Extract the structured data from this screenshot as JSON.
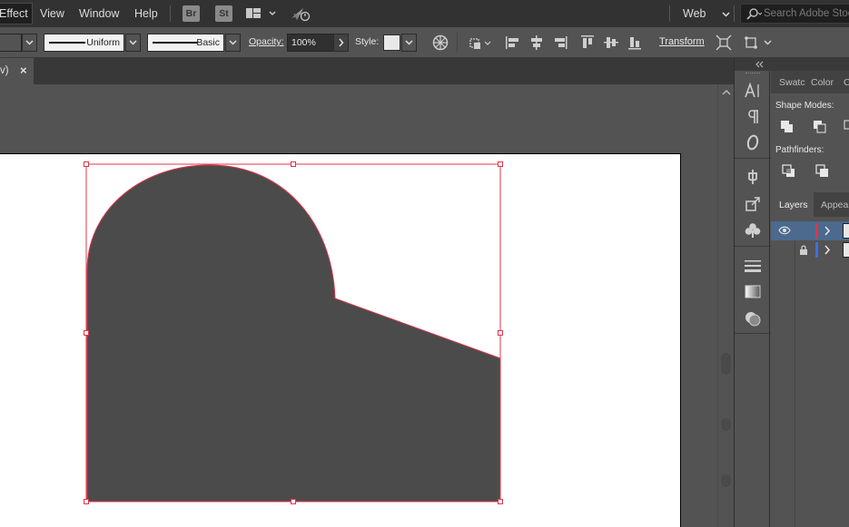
{
  "menubar": {
    "items": [
      {
        "label": "Effect",
        "active": true
      },
      {
        "label": "View"
      },
      {
        "label": "Window"
      },
      {
        "label": "Help"
      }
    ],
    "app_buttons": [
      "Br",
      "St"
    ],
    "workspace": "Web",
    "search_placeholder": "Search Adobe Stock"
  },
  "controlbar": {
    "stroke_profile": "Uniform",
    "brush": "Basic",
    "opacity_label": "Opacity:",
    "opacity_value": "100%",
    "style_label": "Style:",
    "transform_label": "Transform"
  },
  "document_tab": {
    "title_fragment": "v)",
    "close_glyph": "×"
  },
  "panels": {
    "pathfinder_tabs": [
      "Swatc",
      "Color",
      "C"
    ],
    "shape_modes_label": "Shape Modes:",
    "pathfinders_label": "Pathfinders:",
    "layers_tabs": [
      "Layers",
      "Appear"
    ]
  },
  "colors": {
    "shape_fill": "#4b4b4b",
    "selection": "#e0344b",
    "layer_red": "#e0344b",
    "layer_blue": "#3f6fe0"
  }
}
